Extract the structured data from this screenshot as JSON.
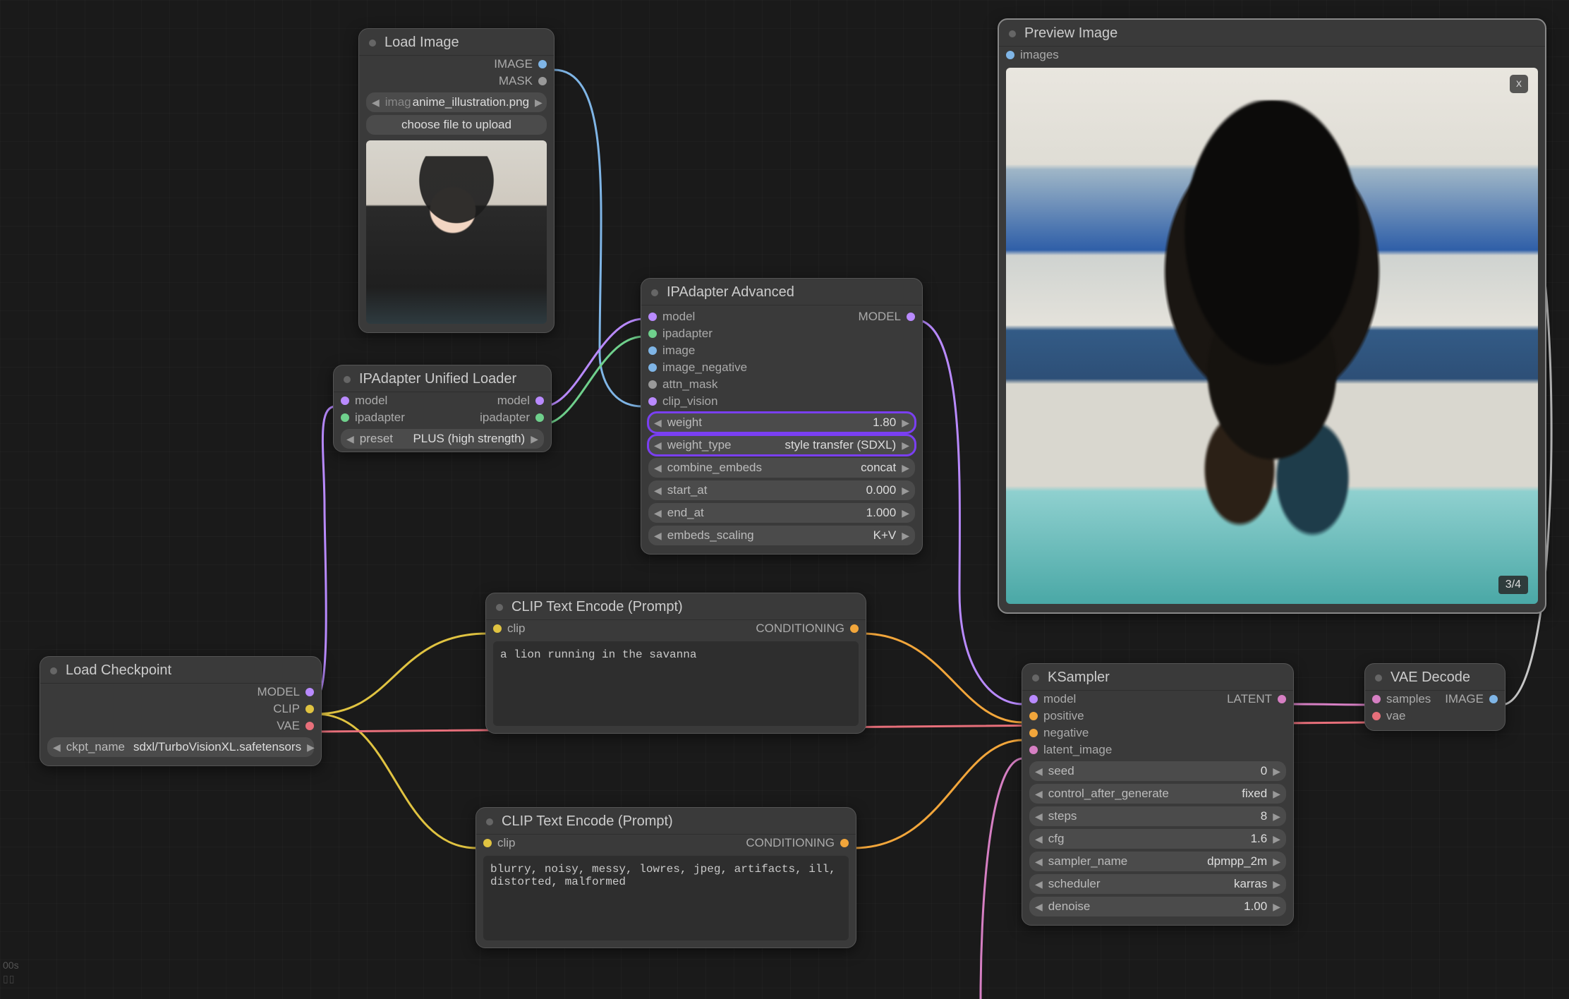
{
  "footer": {
    "time": "00s",
    "bars": "▯▯"
  },
  "nodes": {
    "load_image": {
      "title": "Load Image",
      "out_image": "IMAGE",
      "out_mask": "MASK",
      "file_prefix": "imag",
      "file_name": "anime_illustration.png",
      "upload_btn": "choose file to upload"
    },
    "ip_unified": {
      "title": "IPAdapter Unified Loader",
      "in_model": "model",
      "in_ip": "ipadapter",
      "out_model": "model",
      "out_ip": "ipadapter",
      "preset_label": "preset",
      "preset_value": "PLUS (high strength)"
    },
    "load_ckpt": {
      "title": "Load Checkpoint",
      "out_model": "MODEL",
      "out_clip": "CLIP",
      "out_vae": "VAE",
      "ckpt_label": "ckpt_name",
      "ckpt_value": "sdxl/TurboVisionXL.safetensors"
    },
    "ip_adv": {
      "title": "IPAdapter Advanced",
      "in": {
        "model": "model",
        "ip": "ipadapter",
        "image": "image",
        "imgneg": "image_negative",
        "attn": "attn_mask",
        "clipv": "clip_vision"
      },
      "out_model": "MODEL",
      "params": {
        "weight": {
          "label": "weight",
          "value": "1.80"
        },
        "weight_type": {
          "label": "weight_type",
          "value": "style transfer (SDXL)"
        },
        "combine": {
          "label": "combine_embeds",
          "value": "concat"
        },
        "start": {
          "label": "start_at",
          "value": "0.000"
        },
        "end": {
          "label": "end_at",
          "value": "1.000"
        },
        "scaling": {
          "label": "embeds_scaling",
          "value": "K+V"
        }
      }
    },
    "clip_pos": {
      "title": "CLIP Text Encode (Prompt)",
      "in_clip": "clip",
      "out_cond": "CONDITIONING",
      "text": "a lion running in the savanna"
    },
    "clip_neg": {
      "title": "CLIP Text Encode (Prompt)",
      "in_clip": "clip",
      "out_cond": "CONDITIONING",
      "text": "blurry, noisy, messy, lowres, jpeg, artifacts, ill, distorted, malformed"
    },
    "ksampler": {
      "title": "KSampler",
      "in": {
        "model": "model",
        "pos": "positive",
        "neg": "negative",
        "latent": "latent_image"
      },
      "out_latent": "LATENT",
      "params": {
        "seed": {
          "label": "seed",
          "value": "0"
        },
        "cag": {
          "label": "control_after_generate",
          "value": "fixed"
        },
        "steps": {
          "label": "steps",
          "value": "8"
        },
        "cfg": {
          "label": "cfg",
          "value": "1.6"
        },
        "sampler": {
          "label": "sampler_name",
          "value": "dpmpp_2m"
        },
        "sched": {
          "label": "scheduler",
          "value": "karras"
        },
        "denoise": {
          "label": "denoise",
          "value": "1.00"
        }
      }
    },
    "vae": {
      "title": "VAE Decode",
      "in_samples": "samples",
      "in_vae": "vae",
      "out_image": "IMAGE"
    },
    "preview": {
      "title": "Preview Image",
      "in_images": "images",
      "counter": "3/4",
      "close": "x"
    }
  },
  "colors": {
    "model": "#b98aff",
    "clip": "#e0c341",
    "vae": "#e76f7a",
    "cond": "#f2a63b",
    "image": "#7fb5e6",
    "latent": "#d67fc3",
    "ip": "#6fd08c",
    "mask": "#999"
  }
}
